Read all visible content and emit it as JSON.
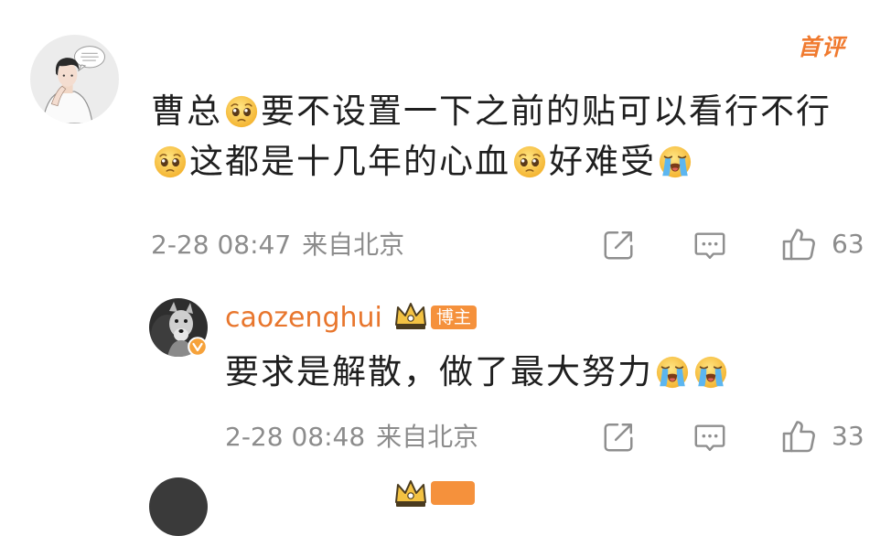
{
  "comment": {
    "avatar_icon": "user-avatar",
    "first_comment_badge": "首评",
    "content": [
      {
        "text": "曹总"
      },
      {
        "emoji": "pleading-face"
      },
      {
        "text": "要不设置一下之前的贴可以看行不行"
      },
      {
        "emoji": "pleading-face"
      },
      {
        "text": "这都是十几年的心血"
      },
      {
        "emoji": "pleading-face"
      },
      {
        "text": "好难受"
      },
      {
        "emoji": "loudly-crying-face"
      }
    ],
    "time": "2-28 08:47",
    "location": "来自北京",
    "actions": {
      "share_icon": "share-icon",
      "comment_icon": "comment-icon",
      "like_icon": "like-icon",
      "like_count": "63"
    }
  },
  "reply": {
    "avatar_icon": "blogger-avatar",
    "verified_icon": "verified-badge-icon",
    "username": "caozenghui",
    "crown_icon": "crown-icon",
    "role_badge": "博主",
    "content": [
      {
        "text": "要求是解散，做了最大努力"
      },
      {
        "emoji": "loudly-crying-face"
      },
      {
        "emoji": "loudly-crying-face"
      }
    ],
    "time": "2-28 08:48",
    "location": "来自北京",
    "actions": {
      "share_icon": "share-icon",
      "comment_icon": "comment-icon",
      "like_icon": "like-icon",
      "like_count": "33"
    }
  },
  "colors": {
    "background": "#ffffff",
    "text": "#1f1f1f",
    "meta_text": "#8c8c8c",
    "icon": "#8f8f8f",
    "username": "#e8762d",
    "first_comment_badge": "#f07a2f",
    "role_badge_bg": "#f5913c",
    "role_badge_text": "#ffffff",
    "verified_badge": "#f6a23a"
  }
}
